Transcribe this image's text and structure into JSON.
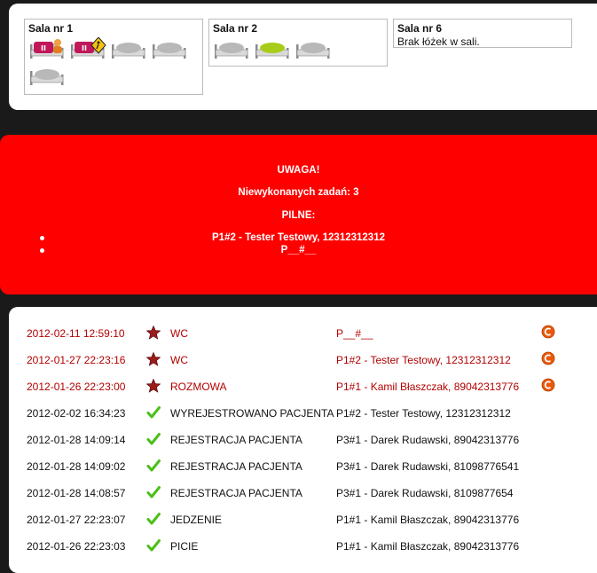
{
  "rooms": [
    {
      "title": "Sala nr 1",
      "note": "",
      "beds": [
        "occupied-paused-person",
        "occupied-paused-warning",
        "empty",
        "empty",
        "empty"
      ]
    },
    {
      "title": "Sala nr 2",
      "note": "",
      "beds": [
        "empty",
        "available",
        "empty"
      ]
    },
    {
      "title": "Sala nr 6",
      "note": "Brak łóżek w sali.",
      "beds": []
    }
  ],
  "alert": {
    "heading": "UWAGA!",
    "pending_label": "Niewykonanych zadań:",
    "pending_count": "3",
    "urgent_label": "PILNE:",
    "urgent_items": [
      "P1#2 - Tester Testowy, 12312312312",
      "P__#__"
    ]
  },
  "colors": {
    "alert_bg": "#ff0000",
    "urgent_text": "#b20000",
    "check": "#4bbf1a",
    "star": "#9b1b1b",
    "action": "#e8590c"
  },
  "log": [
    {
      "date": "2012-02-11 12:59:10",
      "status_icon": "star-icon",
      "event": "WC",
      "patient": "P__#__",
      "urgent": true
    },
    {
      "date": "2012-01-27 22:23:16",
      "status_icon": "star-icon",
      "event": "WC",
      "patient": "P1#2 - Tester Testowy, 12312312312",
      "urgent": true
    },
    {
      "date": "2012-01-26 22:23:00",
      "status_icon": "star-icon",
      "event": "ROZMOWA",
      "patient": "P1#1 - Kamil Błaszczak, 89042313776",
      "urgent": true
    },
    {
      "date": "2012-02-02 16:34:23",
      "status_icon": "check-icon",
      "event": "WYREJESTROWANO PACJENTA",
      "patient": "P1#2 - Tester Testowy, 12312312312",
      "urgent": false
    },
    {
      "date": "2012-01-28 14:09:14",
      "status_icon": "check-icon",
      "event": "REJESTRACJA PACJENTA",
      "patient": "P3#1 - Darek Rudawski, 89042313776",
      "urgent": false
    },
    {
      "date": "2012-01-28 14:09:02",
      "status_icon": "check-icon",
      "event": "REJESTRACJA PACJENTA",
      "patient": "P3#1 - Darek Rudawski, 81098776541",
      "urgent": false
    },
    {
      "date": "2012-01-28 14:08:57",
      "status_icon": "check-icon",
      "event": "REJESTRACJA PACJENTA",
      "patient": "P3#1 - Darek Rudawski, 8109877654",
      "urgent": false
    },
    {
      "date": "2012-01-27 22:23:07",
      "status_icon": "check-icon",
      "event": "JEDZENIE",
      "patient": "P1#1 - Kamil Błaszczak, 89042313776",
      "urgent": false
    },
    {
      "date": "2012-01-26 22:23:03",
      "status_icon": "check-icon",
      "event": "PICIE",
      "patient": "P1#1 - Kamil Błaszczak, 89042313776",
      "urgent": false
    }
  ]
}
